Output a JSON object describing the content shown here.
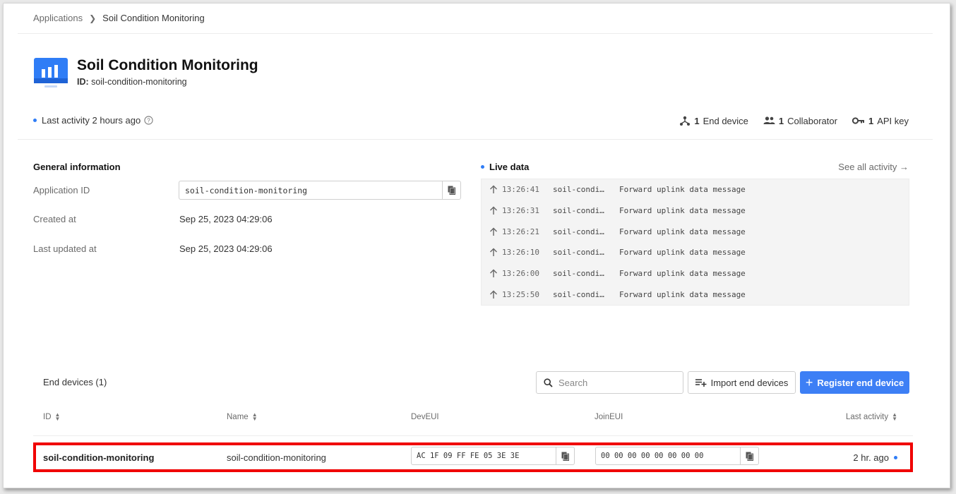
{
  "breadcrumb": {
    "root": "Applications",
    "current": "Soil Condition Monitoring"
  },
  "app": {
    "title": "Soil Condition Monitoring",
    "id_label": "ID:",
    "id_value": "soil-condition-monitoring"
  },
  "activity": {
    "text": "Last activity 2 hours ago"
  },
  "stats": {
    "end_device_count": "1",
    "end_device_label": "End device",
    "collaborator_count": "1",
    "collaborator_label": "Collaborator",
    "api_key_count": "1",
    "api_key_label": "API key"
  },
  "general": {
    "title": "General information",
    "app_id_label": "Application ID",
    "app_id_value": "soil-condition-monitoring",
    "created_label": "Created at",
    "created_value": "Sep 25, 2023 04:29:06",
    "updated_label": "Last updated at",
    "updated_value": "Sep 25, 2023 04:29:06"
  },
  "live": {
    "title": "Live data",
    "see_all": "See all activity →",
    "rows": [
      {
        "time": "13:26:41",
        "device": "soil-condi…",
        "message": "Forward uplink data message"
      },
      {
        "time": "13:26:31",
        "device": "soil-condi…",
        "message": "Forward uplink data message"
      },
      {
        "time": "13:26:21",
        "device": "soil-condi…",
        "message": "Forward uplink data message"
      },
      {
        "time": "13:26:10",
        "device": "soil-condi…",
        "message": "Forward uplink data message"
      },
      {
        "time": "13:26:00",
        "device": "soil-condi…",
        "message": "Forward uplink data message"
      },
      {
        "time": "13:25:50",
        "device": "soil-condi…",
        "message": "Forward uplink data message"
      }
    ]
  },
  "end_devices": {
    "title": "End devices (1)",
    "search_placeholder": "Search",
    "import_label": "Import end devices",
    "register_label": "Register end device",
    "columns": {
      "id": "ID",
      "name": "Name",
      "deveui": "DevEUI",
      "joineui": "JoinEUI",
      "last_activity": "Last activity"
    },
    "rows": [
      {
        "id": "soil-condition-monitoring",
        "name": "soil-condition-monitoring",
        "deveui": "AC 1F 09 FF FE 05 3E 3E",
        "joineui": "00 00 00 00 00 00 00 00",
        "last_activity": "2 hr. ago"
      }
    ]
  },
  "colors": {
    "accent": "#3d7ff5",
    "highlight": "#f00000",
    "live_bg": "#f4f4f4"
  }
}
